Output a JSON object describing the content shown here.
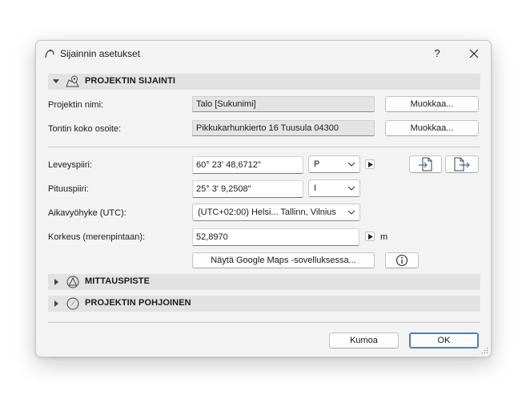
{
  "dialog": {
    "title": "Sijainnin asetukset",
    "help_label": "?",
    "icons": {
      "app": "location-settings-icon",
      "close": "close-icon",
      "grip": "resize-grip-icon"
    }
  },
  "sections": {
    "location": {
      "label": "PROJEKTIN SIJAINTI",
      "icon": "map-pin-icon",
      "expanded": true
    },
    "survey_point": {
      "label": "MITTAUSPISTE",
      "icon": "survey-point-icon",
      "expanded": false
    },
    "north": {
      "label": "PROJEKTIN POHJOINEN",
      "icon": "compass-icon",
      "expanded": false
    }
  },
  "fields": {
    "project_name": {
      "label": "Projektin nimi:",
      "value": "Talo [Sukunimi]",
      "button": "Muokkaa..."
    },
    "site_address": {
      "label": "Tontin koko osoite:",
      "value": "Pikkukarhunkierto 16 Tuusula 04300",
      "button": "Muokkaa..."
    },
    "latitude": {
      "label": "Leveyspiiri:",
      "value": "60° 23' 48,6712\"",
      "hemisphere": "P"
    },
    "longitude": {
      "label": "Pituuspiiri:",
      "value": "25° 3' 9,2508\"",
      "hemisphere": "I"
    },
    "timezone": {
      "label": "Aikavyöhyke (UTC):",
      "value": "(UTC+02:00) Helsi... Tallinn, Vilnius"
    },
    "altitude": {
      "label": "Korkeus (merenpintaan):",
      "value": "52,8970",
      "unit": "m"
    }
  },
  "buttons": {
    "google_maps": "Näytä Google Maps -sovelluksessa...",
    "info_icon": "info-icon",
    "import_icon": "import-file-icon",
    "export_icon": "export-file-icon",
    "cancel": "Kumoa",
    "ok": "OK"
  },
  "colors": {
    "primary_border": "#4a7ebb",
    "section_bg": "#e2e2e2",
    "dialog_bg": "#f3f3f3"
  }
}
